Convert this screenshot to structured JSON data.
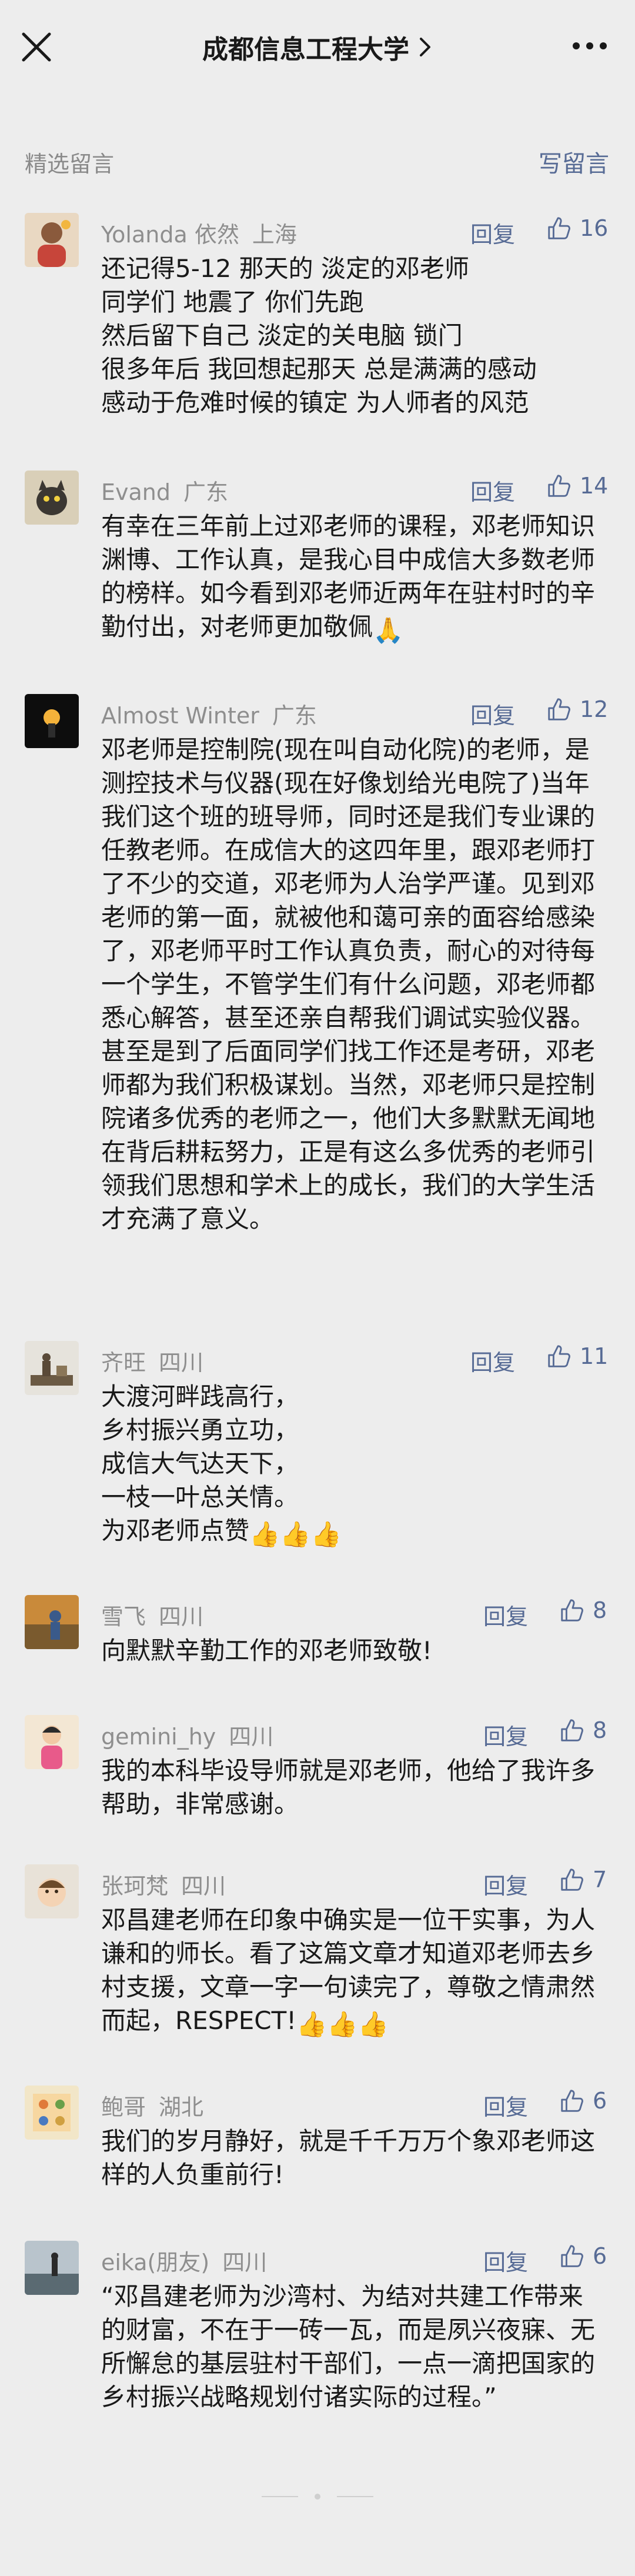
{
  "header": {
    "title": "成都信息工程大学",
    "chevron_icon": "chevron-right-icon",
    "close_icon": "close-icon",
    "more_icon": "more-horizontal-icon"
  },
  "section": {
    "title": "精选留言",
    "write_label": "写留言"
  },
  "reply_label": "回复",
  "comments": [
    {
      "name": "Yolanda 依然",
      "location": "上海",
      "likes": "16",
      "text": "还记得5-12 那天的 淡定的邓老师\n同学们 地震了 你们先跑\n然后留下自己 淡定的关电脑 锁门\n很多年后 我回想起那天 总是满满的感动\n感动于危难时候的镇定  为人师者的风范"
    },
    {
      "name": "Evand",
      "location": "广东",
      "likes": "14",
      "text": "有幸在三年前上过邓老师的课程，邓老师知识渊博、工作认真，是我心目中成信大多数老师的榜样。如今看到邓老师近两年在驻村时的辛勤付出，对老师更加敬佩",
      "emoji": "🙏"
    },
    {
      "name": "Almost Winter",
      "location": "广东",
      "likes": "12",
      "text": "邓老师是控制院(现在叫自动化院)的老师，是测控技术与仪器(现在好像划给光电院了)当年我们这个班的班导师，同时还是我们专业课的任教老师。在成信大的这四年里，跟邓老师打了不少的交道，邓老师为人治学严谨。见到邓老师的第一面，就被他和蔼可亲的面容给感染了，邓老师平时工作认真负责，耐心的对待每一个学生，不管学生们有什么问题，邓老师都悉心解答，甚至还亲自帮我们调试实验仪器。甚至是到了后面同学们找工作还是考研，邓老师都为我们积极谋划。当然，邓老师只是控制院诸多优秀的老师之一，他们大多默默无闻地在背后耕耘努力，正是有这么多优秀的老师引领我们思想和学术上的成长，我们的大学生活才充满了意义。"
    },
    {
      "name": "齐旺",
      "location": "四川",
      "likes": "11",
      "text": "大渡河畔践高行，\n乡村振兴勇立功，\n成信大气达天下，\n一枝一叶总关情。\n为邓老师点赞",
      "emoji": "👍👍👍"
    },
    {
      "name": "雪飞",
      "location": "四川",
      "likes": "8",
      "text": "向默默辛勤工作的邓老师致敬!"
    },
    {
      "name": "gemini_hy",
      "location": "四川",
      "likes": "8",
      "text": "我的本科毕设导师就是邓老师，他给了我许多帮助，非常感谢。"
    },
    {
      "name": "张珂梵",
      "location": "四川",
      "likes": "7",
      "text": "邓昌建老师在印象中确实是一位干实事，为人谦和的师长。看了这篇文章才知道邓老师去乡村支援，文章一字一句读完了，尊敬之情肃然而起，RESPECT!",
      "emoji": "👍👍👍"
    },
    {
      "name": "鲍哥",
      "location": "湖北",
      "likes": "6",
      "text": "我们的岁月静好，就是千千万万个象邓老师这样的人负重前行!"
    },
    {
      "name": "eika(朋友)",
      "location": "四川",
      "likes": "6",
      "text": "“邓昌建老师为沙湾村、为结对共建工作带来的财富，不在于一砖一瓦，而是夙兴夜寐、无所懈怠的基层驻村干部们，一点一滴把国家的乡村振兴战略规划付诸实际的过程。”"
    }
  ],
  "colors": {
    "background": "#ededed",
    "link": "#576b95",
    "meta": "#8e8e8e",
    "text": "#191919"
  }
}
